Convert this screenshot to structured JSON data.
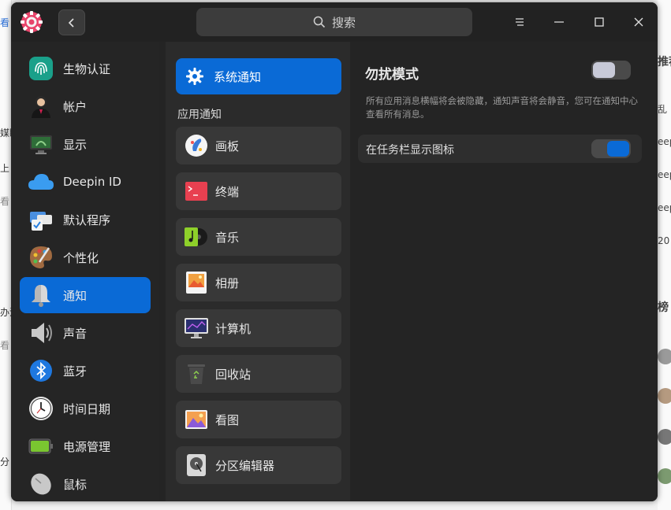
{
  "background_app": {
    "left_fragments": [
      "看",
      "媒眼",
      "上",
      "看",
      "办法",
      "看",
      "分"
    ],
    "right_fragments": [
      "推荐",
      "乱",
      "eep",
      "eep",
      "eep",
      "20",
      "榜"
    ]
  },
  "titlebar": {
    "search_placeholder": "搜索"
  },
  "sidebar": {
    "items": [
      {
        "label": "生物认证",
        "icon": "fingerprint-icon",
        "active": false
      },
      {
        "label": "帐户",
        "icon": "account-icon",
        "active": false
      },
      {
        "label": "显示",
        "icon": "display-icon",
        "active": false
      },
      {
        "label": "Deepin ID",
        "icon": "cloud-icon",
        "active": false
      },
      {
        "label": "默认程序",
        "icon": "default-apps-icon",
        "active": false
      },
      {
        "label": "个性化",
        "icon": "personalization-icon",
        "active": false
      },
      {
        "label": "通知",
        "icon": "bell-icon",
        "active": true
      },
      {
        "label": "声音",
        "icon": "speaker-icon",
        "active": false
      },
      {
        "label": "蓝牙",
        "icon": "bluetooth-icon",
        "active": false
      },
      {
        "label": "时间日期",
        "icon": "clock-icon",
        "active": false
      },
      {
        "label": "电源管理",
        "icon": "battery-icon",
        "active": false
      },
      {
        "label": "鼠标",
        "icon": "mouse-icon",
        "active": false
      }
    ]
  },
  "notifications": {
    "system_label": "系统通知",
    "section_title": "应用通知",
    "apps": [
      {
        "label": "画板",
        "icon": "draw-icon"
      },
      {
        "label": "终端",
        "icon": "terminal-icon"
      },
      {
        "label": "音乐",
        "icon": "music-icon"
      },
      {
        "label": "相册",
        "icon": "album-icon"
      },
      {
        "label": "计算机",
        "icon": "computer-icon"
      },
      {
        "label": "回收站",
        "icon": "trash-icon"
      },
      {
        "label": "看图",
        "icon": "image-viewer-icon"
      },
      {
        "label": "分区编辑器",
        "icon": "partition-editor-icon"
      }
    ]
  },
  "detail": {
    "dnd_title": "勿扰模式",
    "dnd_enabled": false,
    "dnd_description": "所有应用消息横幅将会被隐藏，通知声音将会静音，您可在通知中心查看所有消息。",
    "taskbar_label": "在任务栏显示图标",
    "taskbar_enabled": true
  },
  "colors": {
    "accent": "#0a6ad6",
    "window_bg": "#242424"
  }
}
